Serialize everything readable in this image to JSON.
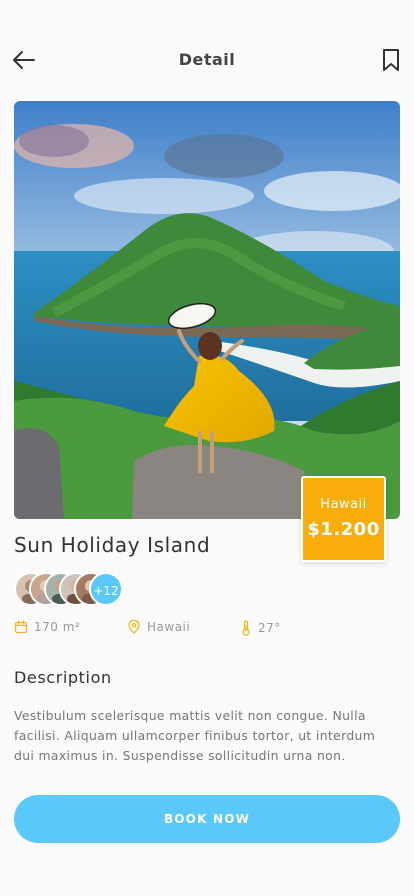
{
  "header": {
    "title": "Detail",
    "back_icon": "arrow-left-icon",
    "bookmark_icon": "bookmark-icon"
  },
  "place": {
    "title": "Sun Holiday Island",
    "location": "Hawaii",
    "price": "$1.200",
    "area": "170 m²",
    "temperature": "27°"
  },
  "visitors": {
    "more_count": "+12"
  },
  "description": {
    "heading": "Description",
    "text": "Vestibulum scelerisque mattis velit non congue. Nulla facilisi. Aliquam ullamcorper finibus tortor, ut interdum dui maximus in. Suspendisse sollicitudin urna non."
  },
  "cta": {
    "label": "BOOK NOW"
  },
  "colors": {
    "accent": "#5bc8fa",
    "price_card": "#f9ad0c",
    "icon_yellow": "#f5b81a"
  }
}
